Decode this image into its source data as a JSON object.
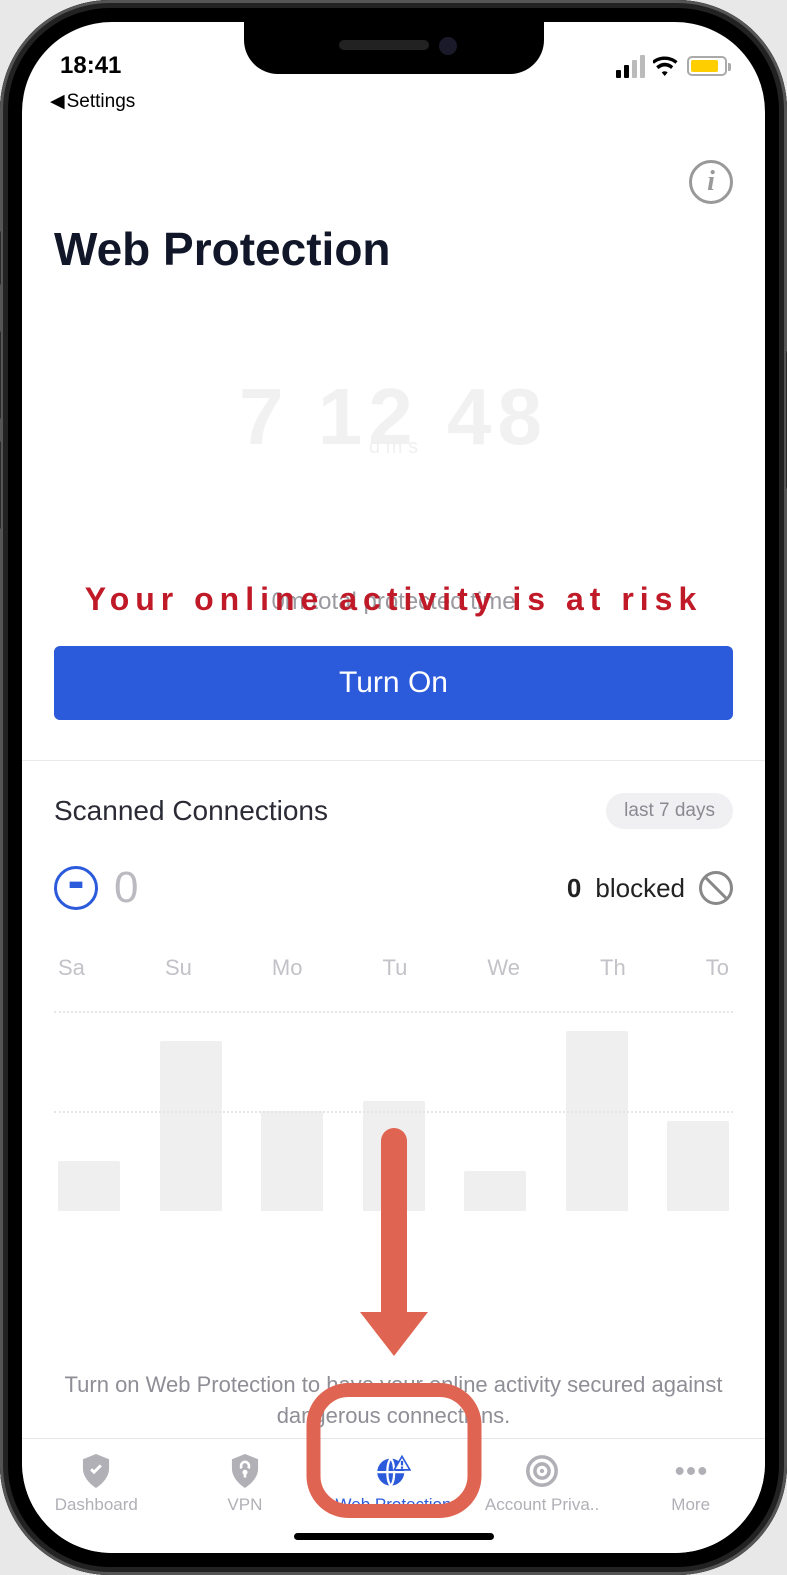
{
  "status": {
    "time": "18:41",
    "breadcrumb": "Settings"
  },
  "header": {
    "title": "Web Protection"
  },
  "ghost": {
    "value": "7 12 48",
    "units": "d       m       s"
  },
  "risk": {
    "message": "Your online activity is at risk"
  },
  "protected": {
    "text": "0m total protected time"
  },
  "action": {
    "turn_on": "Turn On"
  },
  "scanned": {
    "title": "Scanned Connections",
    "range": "last 7 days",
    "scanned_count": "0",
    "blocked_count": "0",
    "blocked_label": "blocked"
  },
  "hint": {
    "text": "Turn on Web Protection to have your online activity secured against dangerous connections."
  },
  "tabs": {
    "dashboard": "Dashboard",
    "vpn": "VPN",
    "web": "Web Protection",
    "account": "Account Priva..",
    "more": "More"
  },
  "chart_data": {
    "type": "bar",
    "categories": [
      "Sa",
      "Su",
      "Mo",
      "Tu",
      "We",
      "Th",
      "To"
    ],
    "values": [
      25,
      85,
      50,
      55,
      20,
      90,
      45
    ],
    "title": "Scanned Connections",
    "xlabel": "",
    "ylabel": "",
    "ylim": [
      0,
      100
    ]
  }
}
